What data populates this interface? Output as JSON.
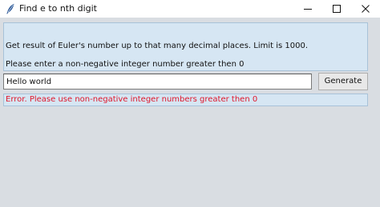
{
  "window": {
    "title": "Find e to nth digit",
    "controls": {
      "minimize": "minimize-icon",
      "maximize": "maximize-icon",
      "close": "close-icon"
    }
  },
  "info": {
    "line1": "Get result of Euler's number up to that many decimal places. Limit is 1000.",
    "line2": "Please enter a non-negative integer number greater then 0"
  },
  "input": {
    "value": "Hello world"
  },
  "generate_button": {
    "label": "Generate"
  },
  "error": {
    "message": "Error. Please use non-negative integer numbers greater then 0"
  },
  "colors": {
    "window_background": "#d9dde2",
    "panel_background": "#d6e6f3",
    "error_text": "#e0162b"
  }
}
